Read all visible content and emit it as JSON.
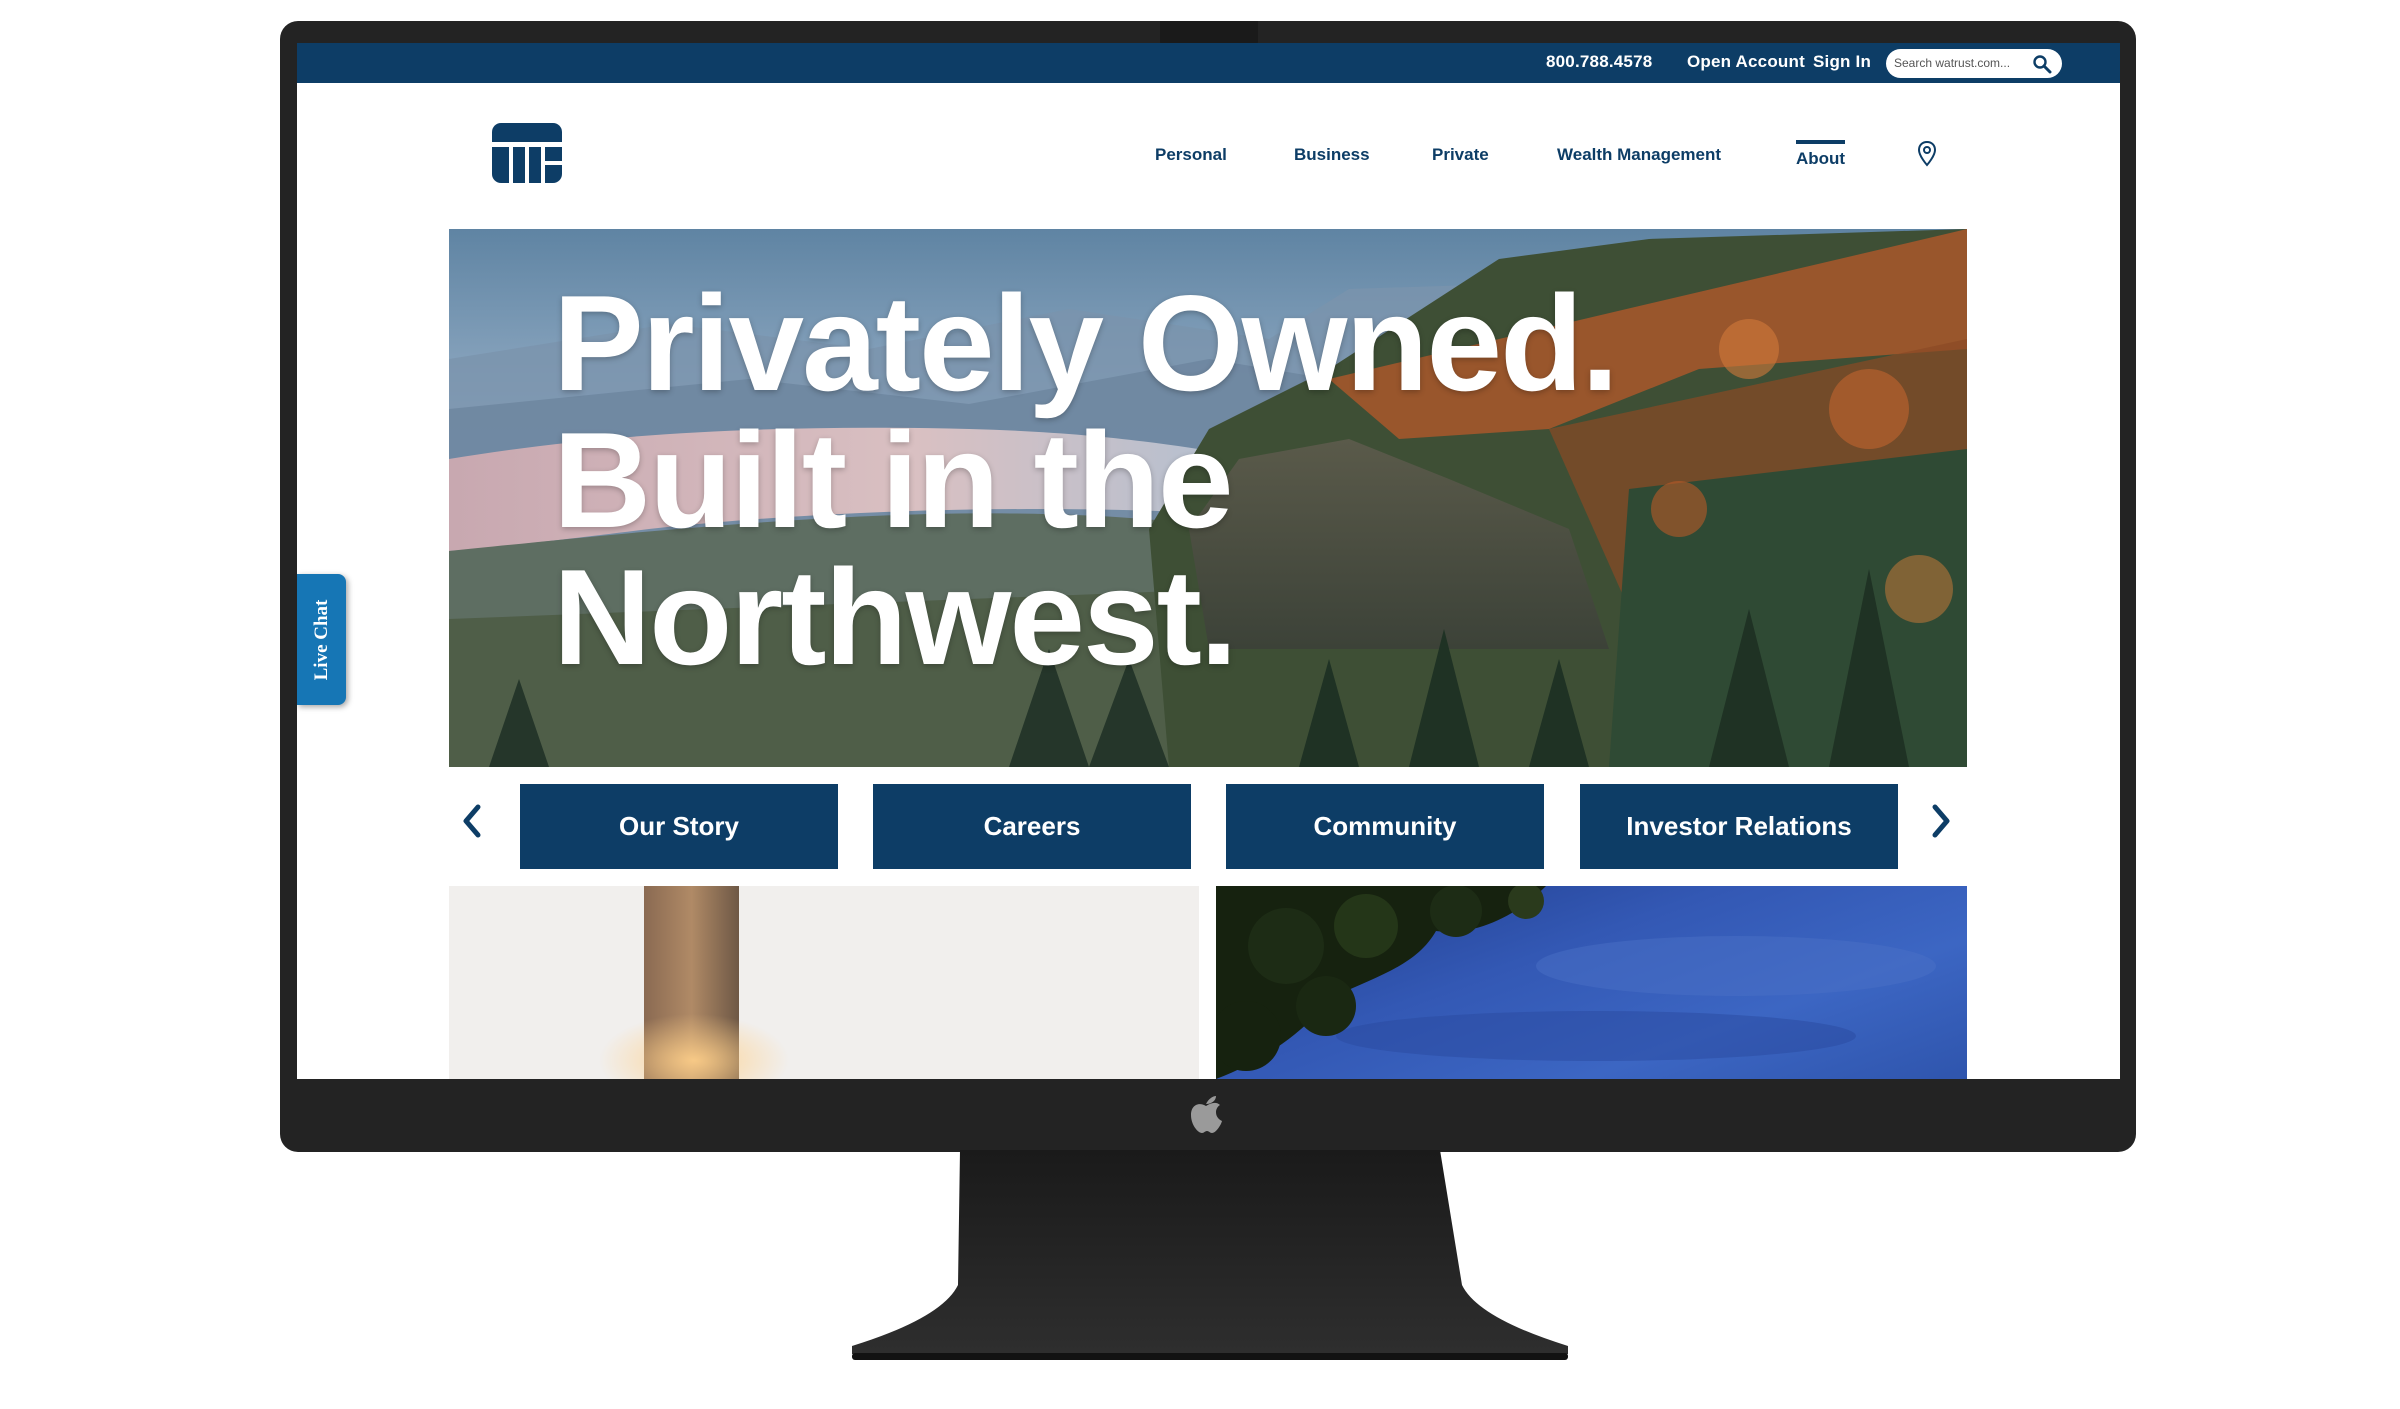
{
  "topbar": {
    "phone": "800.788.4578",
    "open_account": "Open Account",
    "sign_in": "Sign In",
    "search_placeholder": "Search watrust.com..."
  },
  "nav": {
    "items": [
      {
        "label": "Personal"
      },
      {
        "label": "Business"
      },
      {
        "label": "Private"
      },
      {
        "label": "Wealth Management"
      },
      {
        "label": "About",
        "active": true
      }
    ]
  },
  "hero": {
    "title": "Privately Owned.\nBuilt in the\nNorthwest."
  },
  "live_chat": {
    "label": "Live Chat"
  },
  "tiles": [
    {
      "label": "Our Story"
    },
    {
      "label": "Careers"
    },
    {
      "label": "Community"
    },
    {
      "label": "Investor Relations"
    }
  ],
  "icons": {
    "prev": "chevron-left-icon",
    "next": "chevron-right-icon",
    "search": "search-icon",
    "location": "map-pin-icon"
  },
  "colors": {
    "brand_navy": "#0d3d66",
    "chat_blue": "#1676b5",
    "monitor_bezel": "#232323"
  }
}
